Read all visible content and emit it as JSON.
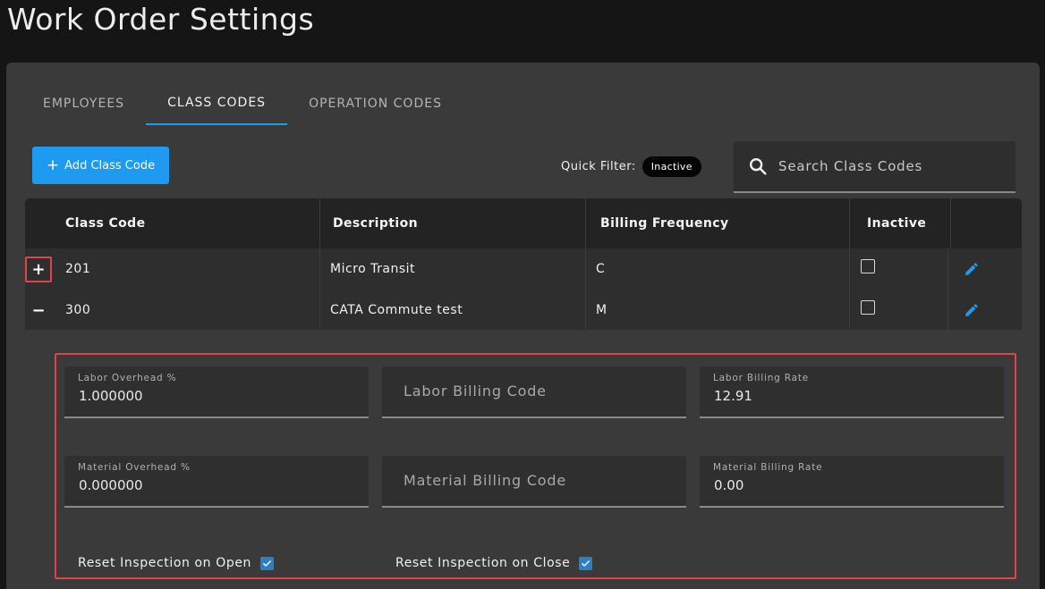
{
  "page": {
    "title": "Work Order Settings"
  },
  "tabs": [
    {
      "label": "EMPLOYEES",
      "active": false
    },
    {
      "label": "CLASS CODES",
      "active": true
    },
    {
      "label": "OPERATION CODES",
      "active": false
    }
  ],
  "toolbar": {
    "add_label": "Add Class Code",
    "quick_filter_label": "Quick Filter:",
    "quick_filter_chip": "Inactive",
    "search_placeholder": "Search Class Codes"
  },
  "table": {
    "columns": [
      "Class Code",
      "Description",
      "Billing Frequency",
      "Inactive"
    ],
    "rows": [
      {
        "expander": "+",
        "code": "201",
        "description": "Micro Transit",
        "frequency": "C",
        "inactive": false
      },
      {
        "expander": "−",
        "code": "300",
        "description": "CATA Commute test",
        "frequency": "M",
        "inactive": false
      }
    ]
  },
  "detail": {
    "labor_overhead_label": "Labor Overhead %",
    "labor_overhead_value": "1.000000",
    "labor_billing_code_placeholder": "Labor Billing Code",
    "labor_billing_rate_label": "Labor Billing Rate",
    "labor_billing_rate_value": "12.91",
    "material_overhead_label": "Material Overhead %",
    "material_overhead_value": "0.000000",
    "material_billing_code_placeholder": "Material Billing Code",
    "material_billing_rate_label": "Material Billing Rate",
    "material_billing_rate_value": "0.00",
    "reset_on_open_label": "Reset Inspection on Open",
    "reset_on_open_checked": true,
    "reset_on_close_label": "Reset Inspection on Close",
    "reset_on_close_checked": true
  },
  "colors": {
    "accent": "#1e9bf0",
    "highlight": "#e2434a",
    "checkbox_checked": "#2b7fc4"
  },
  "icons": {
    "search": "search-icon",
    "edit": "pencil-icon",
    "add": "plus-icon"
  }
}
